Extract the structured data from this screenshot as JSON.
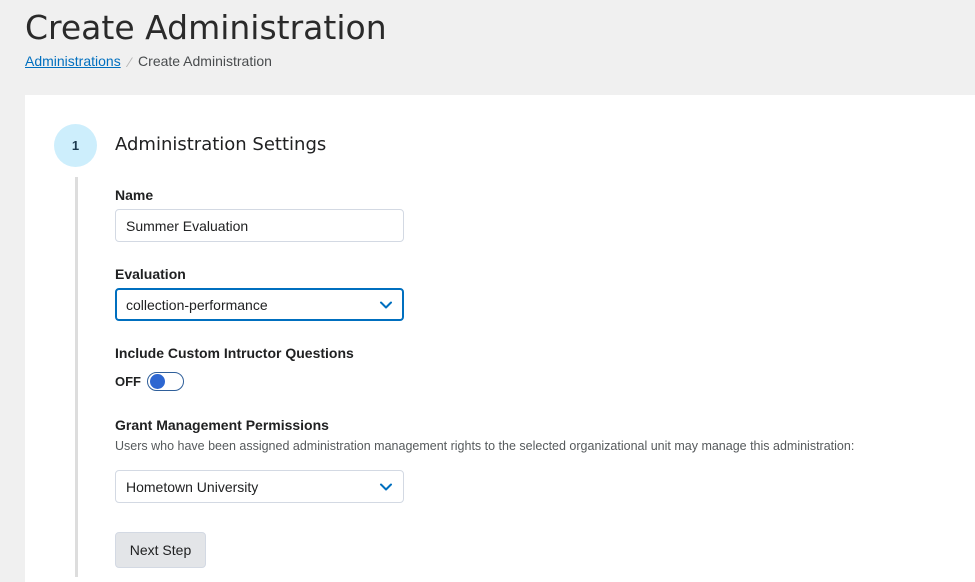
{
  "page": {
    "title": "Create Administration"
  },
  "breadcrumb": {
    "link": "Administrations",
    "current": "Create Administration"
  },
  "step": {
    "number": "1",
    "title": "Administration Settings"
  },
  "form": {
    "name_label": "Name",
    "name_value": "Summer Evaluation",
    "evaluation_label": "Evaluation",
    "evaluation_value": "collection-performance",
    "custom_questions_label": "Include Custom Intructor Questions",
    "toggle_state": "OFF",
    "permissions_label": "Grant Management Permissions",
    "permissions_help": "Users who have been assigned administration management rights to the selected organizational unit may manage this administration:",
    "org_unit_value": "Hometown University",
    "next_button": "Next Step"
  },
  "colors": {
    "accent": "#006fbf",
    "step_circle": "#cdeefc",
    "toggle_knob": "#2e67d1"
  }
}
